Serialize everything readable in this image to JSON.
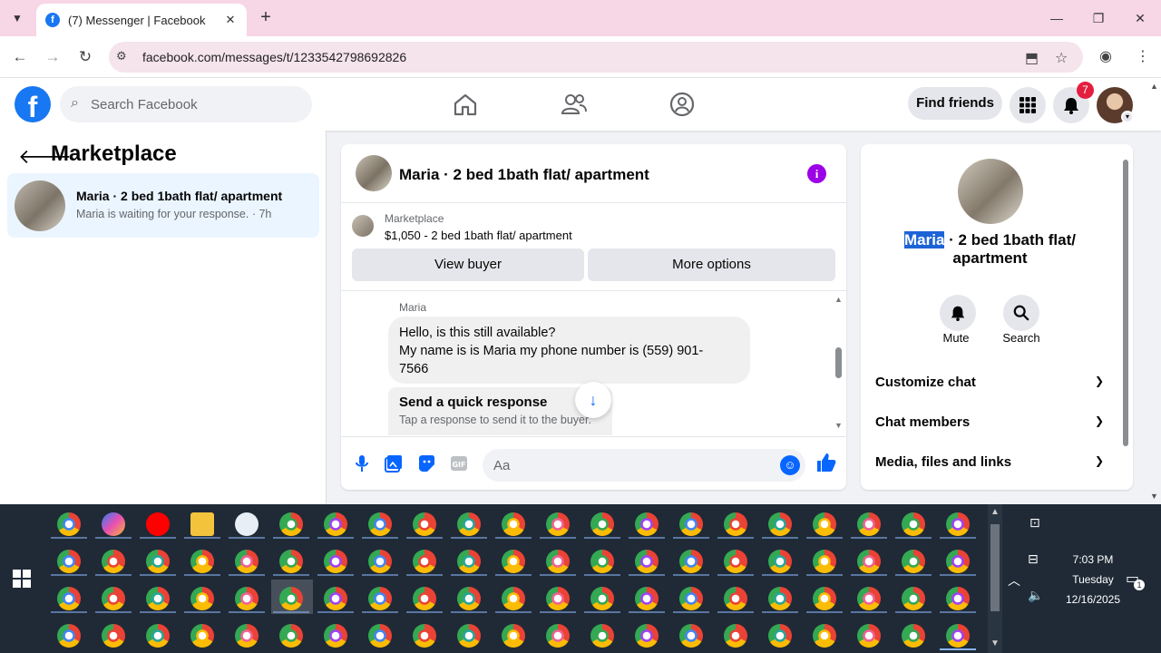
{
  "browser": {
    "tab_title": "(7) Messenger | Facebook",
    "url": "facebook.com/messages/t/1233542798692826"
  },
  "header": {
    "search_placeholder": "Search Facebook",
    "find_friends": "Find friends",
    "notifications_count": "7"
  },
  "left": {
    "title": "Marketplace",
    "conversation": {
      "name": "Maria · 2 bed 1bath flat/ apartment",
      "subtitle": "Maria is waiting for your response. · 7h"
    }
  },
  "chat": {
    "title": "Maria · 2 bed 1bath flat/ apartment",
    "listing_label": "Marketplace",
    "listing_price": "$1,050 - 2 bed 1bath flat/ apartment",
    "view_buyer": "View buyer",
    "more_options": "More options",
    "sender": "Maria",
    "message": "Hello, is this still available?\nMy name is is Maria my phone number is (559) 901-7566",
    "message_line1": "Hello, is this still available?",
    "message_line2": "My name is is Maria my phone number is (559) 901-",
    "message_line3": "7566",
    "quick_title": "Send a quick response",
    "quick_sub": "Tap a response to send it to the buyer.",
    "input_placeholder": "Aa"
  },
  "right": {
    "title_highlight": "Maria",
    "title_rest": " · 2 bed 1bath flat/ apartment",
    "mute": "Mute",
    "search": "Search",
    "rows": [
      "Customize chat",
      "Chat members",
      "Media, files and links"
    ]
  },
  "taskbar": {
    "time": "7:03 PM",
    "day": "Tuesday",
    "date": "12/16/2025",
    "notif_count": "1"
  },
  "colors": {
    "fb_blue": "#1877f2",
    "messenger_blue": "#0866ff",
    "info_purple": "#9c00e6",
    "badge_red": "#e41e3f",
    "tab_bar": "#f7d6e6"
  }
}
